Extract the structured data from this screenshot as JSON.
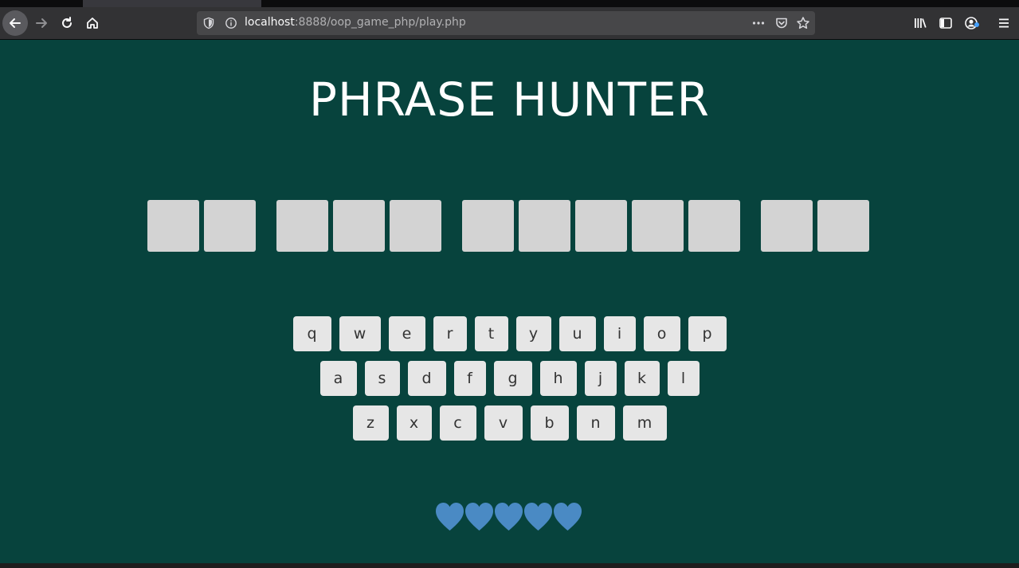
{
  "browser": {
    "url_host": "localhost",
    "url_path": ":8888/oop_game_php/play.php",
    "more_label": "•••"
  },
  "game": {
    "title": "PHRASE HUNTER",
    "phrase_words": [
      2,
      3,
      5,
      2
    ],
    "keyboard": {
      "rows": [
        [
          "q",
          "w",
          "e",
          "r",
          "t",
          "y",
          "u",
          "i",
          "o",
          "p"
        ],
        [
          "a",
          "s",
          "d",
          "f",
          "g",
          "h",
          "j",
          "k",
          "l"
        ],
        [
          "z",
          "x",
          "c",
          "v",
          "b",
          "n",
          "m"
        ]
      ]
    },
    "lives": 5,
    "colors": {
      "background": "#07433d",
      "letter_box": "#d3d3d3",
      "key": "#e6e6e6",
      "heart": "#4a8ac4"
    }
  }
}
